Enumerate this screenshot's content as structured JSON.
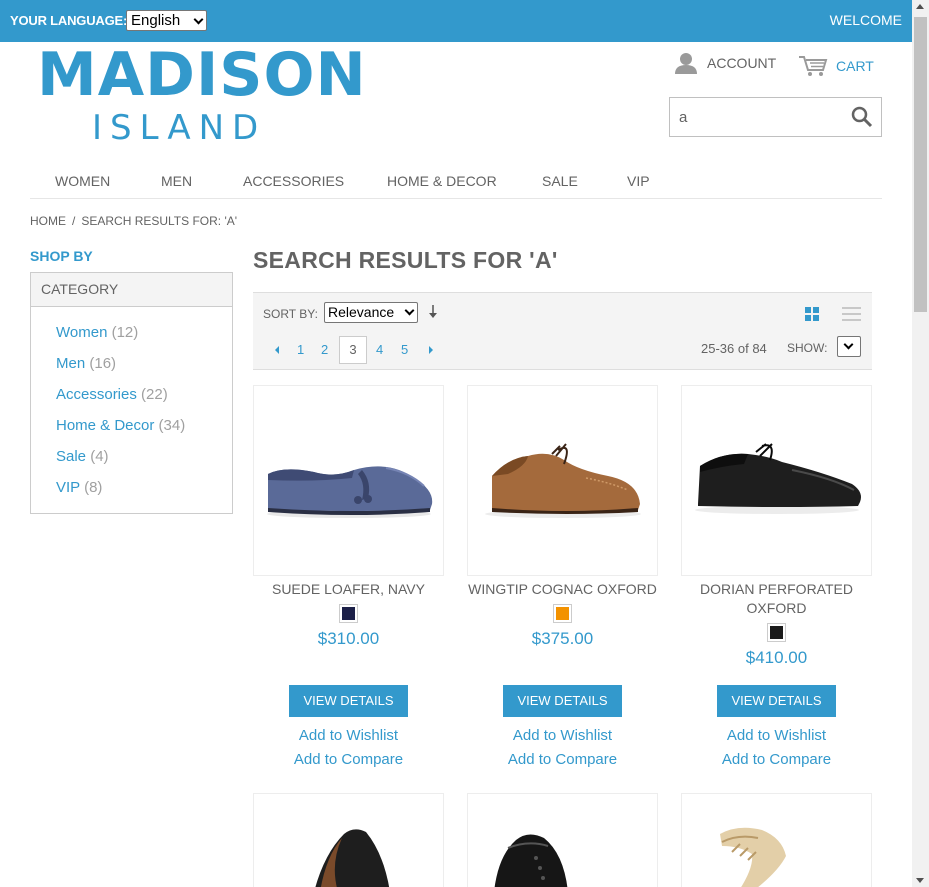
{
  "topbar": {
    "language_label": "YOUR LANGUAGE:",
    "language_value": "English",
    "welcome": "WELCOME"
  },
  "logo": {
    "main": "MADISON",
    "sub": "ISLAND"
  },
  "header": {
    "account": "ACCOUNT",
    "cart": "CART"
  },
  "search": {
    "value": "a"
  },
  "nav": [
    "WOMEN",
    "MEN",
    "ACCESSORIES",
    "HOME & DECOR",
    "SALE",
    "VIP"
  ],
  "breadcrumb": {
    "home": "HOME",
    "sep": "/",
    "current": "SEARCH RESULTS FOR: 'A'"
  },
  "sidebar": {
    "shop_by": "SHOP BY",
    "category_title": "CATEGORY",
    "categories": [
      {
        "name": "Women",
        "count": "(12)"
      },
      {
        "name": "Men",
        "count": "(16)"
      },
      {
        "name": "Accessories",
        "count": "(22)"
      },
      {
        "name": "Home & Decor",
        "count": "(34)"
      },
      {
        "name": "Sale",
        "count": "(4)"
      },
      {
        "name": "VIP",
        "count": "(8)"
      }
    ]
  },
  "main": {
    "title": "SEARCH RESULTS FOR 'A'",
    "sort_label": "SORT BY:",
    "sort_value": "Relevance",
    "pages": [
      "1",
      "2",
      "3",
      "4",
      "5"
    ],
    "current_page": "3",
    "count": "25-36 of 84",
    "show_label": "SHOW:"
  },
  "products": [
    {
      "name": "SUEDE LOAFER, NAVY",
      "swatch": "#1c2048",
      "price": "$310.00",
      "button": "VIEW DETAILS",
      "wishlist": "Add to Wishlist",
      "compare": "Add to Compare"
    },
    {
      "name": "WINGTIP COGNAC OXFORD",
      "swatch": "#f39200",
      "price": "$375.00",
      "button": "VIEW DETAILS",
      "wishlist": "Add to Wishlist",
      "compare": "Add to Compare"
    },
    {
      "name": "DORIAN PERFORATED OXFORD",
      "swatch": "#1b1b1b",
      "price": "$410.00",
      "button": "VIEW DETAILS",
      "wishlist": "Add to Wishlist",
      "compare": "Add to Compare"
    }
  ],
  "colors": {
    "brand": "#3399cc",
    "text": "#636363"
  }
}
